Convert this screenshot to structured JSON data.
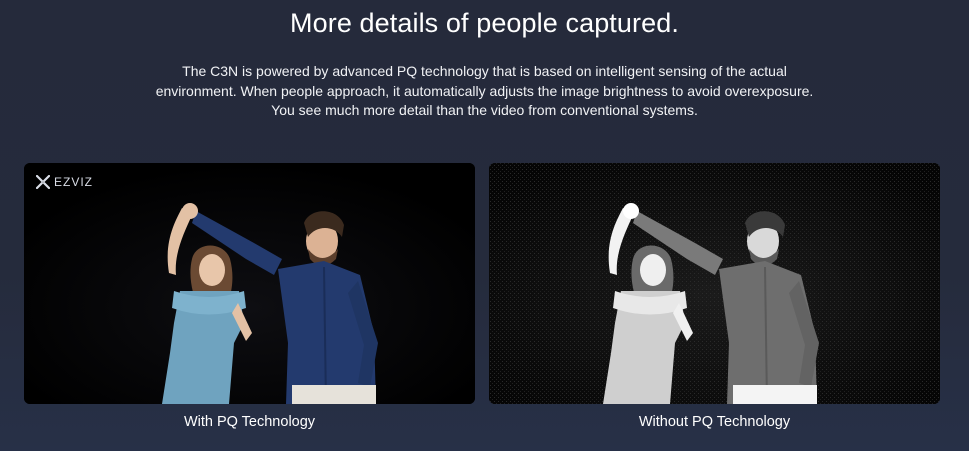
{
  "heading": "More details of people captured.",
  "description": "The C3N is powered by advanced PQ technology that is based on intelligent sensing of the actual environment. When people approach, it automatically adjusts the image brightness to avoid overexposure. You see much more detail than the video from conventional systems.",
  "comparison": {
    "with": {
      "caption": "With PQ Technology",
      "logo_text": "EZVIZ"
    },
    "without": {
      "caption": "Without PQ Technology"
    }
  },
  "colors": {
    "background": "#252a3b",
    "dress_color": "#6fa3bf",
    "shirt_color": "#233a6e"
  }
}
